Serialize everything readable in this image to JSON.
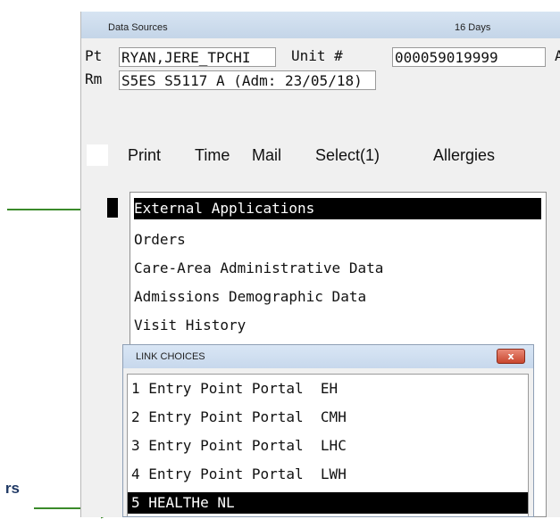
{
  "window": {
    "title": "Data Sources",
    "days": "16 Days"
  },
  "patient": {
    "pt_label": "Pt",
    "name": "RYAN,JERE_TPCHI",
    "unit_label": "Unit #",
    "unit": "000059019999",
    "trailing": "A",
    "rm_label": "Rm",
    "room": "S5ES S5117 A (Adm: 23/05/18)"
  },
  "menu": {
    "items": [
      "Print",
      "Time",
      "Mail",
      "Select(1)",
      "Allergies"
    ]
  },
  "list": {
    "options": [
      "External Applications",
      "Orders",
      "Care-Area Administrative Data",
      "Admissions Demographic Data",
      "Visit History"
    ],
    "selected_index": 0
  },
  "popup": {
    "title": "LINK CHOICES",
    "close_glyph": "x",
    "items": [
      "1 Entry Point Portal  EH",
      "2 Entry Point Portal  CMH",
      "3 Entry Point Portal  LHC",
      "4 Entry Point Portal  LWH",
      "5 HEALTHe NL"
    ],
    "selected_index": 4
  },
  "annotation": {
    "side_label": "rs",
    "arrow_color": "#3a8a2a",
    "label_color": "#1f3864"
  }
}
